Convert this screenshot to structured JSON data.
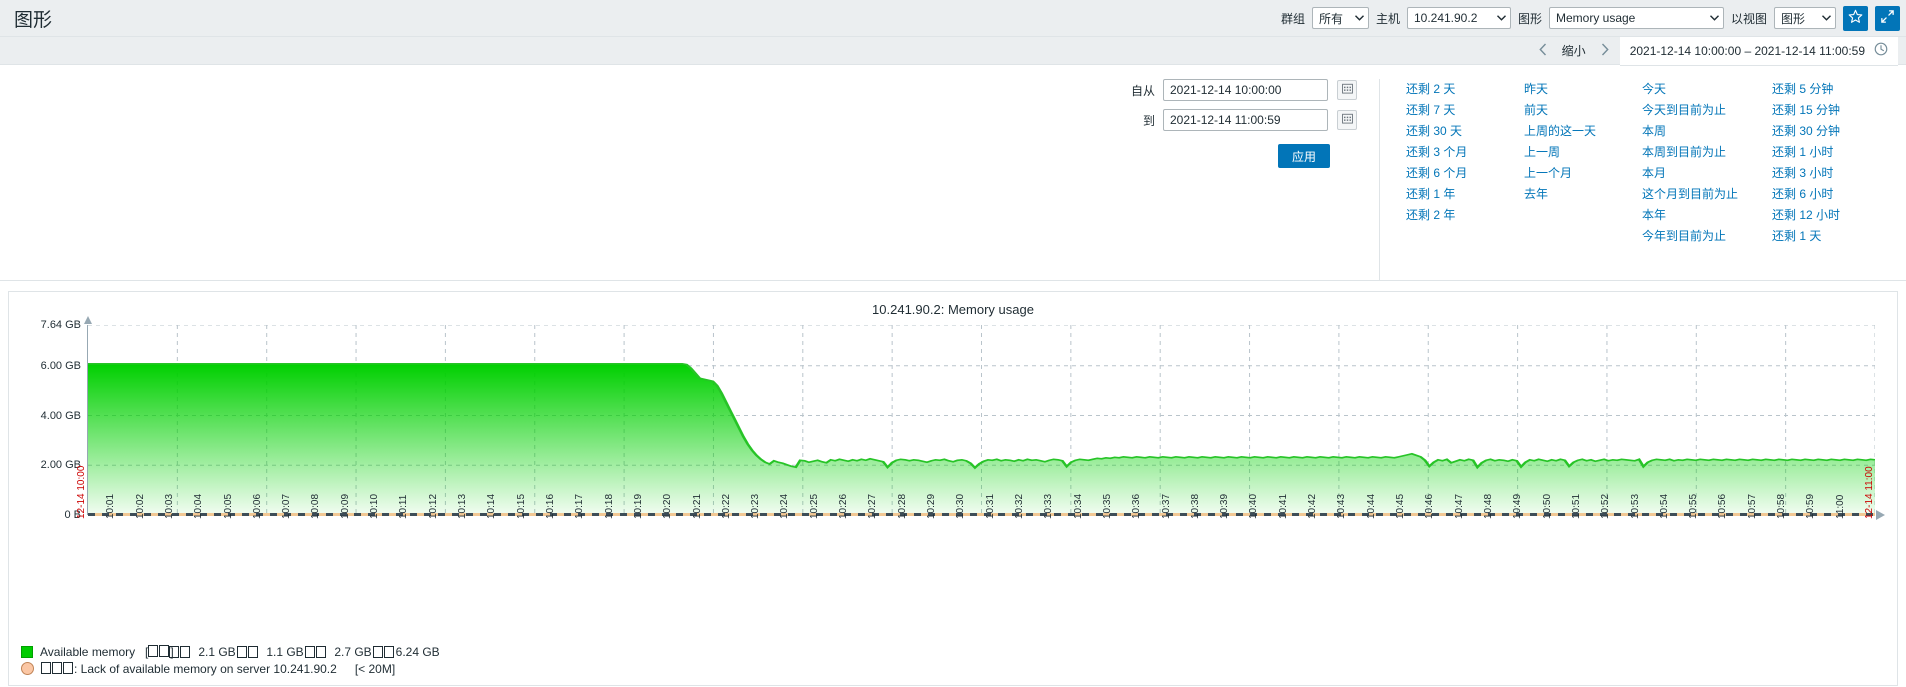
{
  "header": {
    "title": "图形",
    "group_label": "群组",
    "group_value": "所有",
    "host_label": "主机",
    "host_value": "10.241.90.2",
    "graph_label": "图形",
    "graph_value": "Memory usage",
    "view_label": "以视图",
    "view_value": "图形",
    "favorite_icon": "star-icon",
    "fullscreen_icon": "expand-icon"
  },
  "timebar": {
    "prev_icon": "chevron-left-icon",
    "zoom_out_label": "缩小",
    "next_icon": "chevron-right-icon",
    "range_text": "2021-12-14 10:00:00 – 2021-12-14 11:00:59",
    "clock_icon": "clock-icon"
  },
  "filter": {
    "from_label": "自从",
    "from_value": "2021-12-14 10:00:00",
    "to_label": "到",
    "to_value": "2021-12-14 11:00:59",
    "calendar_icon": "calendar-icon",
    "apply_label": "应用",
    "quick_columns": [
      [
        "还剩 2 天",
        "还剩 7 天",
        "还剩 30 天",
        "还剩 3 个月",
        "还剩 6 个月",
        "还剩 1 年",
        "还剩 2 年"
      ],
      [
        "昨天",
        "前天",
        "上周的这一天",
        "上一周",
        "上一个月",
        "去年"
      ],
      [
        "今天",
        "今天到目前为止",
        "本周",
        "本周到目前为止",
        "本月",
        "这个月到目前为止",
        "本年",
        "今年到目前为止"
      ],
      [
        "还剩 5 分钟",
        "还剩 15 分钟",
        "还剩 30 分钟",
        "还剩 1 小时",
        "还剩 3 小时",
        "还剩 6 小时",
        "还剩 12 小时",
        "还剩 1 天"
      ]
    ]
  },
  "chart_data": {
    "type": "area",
    "title": "10.241.90.2: Memory usage",
    "xlabel": "",
    "ylabel": "",
    "ylim": [
      0,
      7.64
    ],
    "yticks": [
      "0 B",
      "2.00 GB",
      "4.00 GB",
      "6.00 GB",
      "7.64 GB"
    ],
    "ytick_values": [
      0,
      2,
      4,
      6,
      7.64
    ],
    "grid": true,
    "legend_position": "bottom-left",
    "series": [
      {
        "name": "Available memory",
        "color": "#00cc00",
        "unit": "GB",
        "stats": {
          "min": "2.1 GB",
          "avg": "1.1 GB",
          "max": "2.7 GB",
          "last": "6.24 GB"
        },
        "values": [
          6.08,
          6.08,
          6.08,
          6.08,
          6.08,
          6.08,
          6.08,
          6.08,
          6.08,
          6.08,
          6.08,
          6.08,
          6.08,
          6.08,
          6.08,
          6.08,
          6.08,
          6.08,
          6.08,
          6.08,
          6.08,
          6.08,
          6.08,
          6.08,
          6.08,
          6.08,
          6.08,
          6.08,
          6.08,
          6.08,
          6.08,
          6.08,
          6.08,
          6.08,
          6.08,
          6.08,
          6.08,
          6.08,
          6.08,
          6.08,
          6.08,
          6.08,
          6.08,
          6.08,
          6.08,
          6.08,
          6.08,
          6.08,
          6.08,
          6.08,
          6.08,
          6.08,
          6.08,
          6.08,
          6.08,
          6.08,
          6.08,
          6.08,
          6.08,
          6.08,
          6.08,
          6.08,
          6.08,
          6.08,
          6.08,
          6.08,
          6.08,
          6.08,
          6.08,
          6.08,
          6.08,
          6.08,
          6.08,
          6.08,
          6.08,
          6.08,
          6.08,
          6.08,
          6.08,
          6.08,
          6.08,
          6.08,
          6.08,
          6.08,
          6.08,
          6.08,
          6.08,
          6.08,
          6.08,
          6.08,
          6.08,
          6.08,
          6.08,
          6.08,
          6.08,
          6.08,
          6.08,
          6.08,
          6.08,
          6.08,
          6.08,
          6.08,
          6.08,
          6.08,
          6.08,
          6.08,
          6.08,
          6.08,
          6.08,
          6.08,
          6.08,
          6.08,
          6.08,
          6.08,
          6.08,
          6.08,
          6.08,
          6.08,
          6.08,
          6.08,
          6.08,
          6.08,
          6.08,
          6.08,
          6.08,
          6.08,
          6.08,
          6.08,
          6.08,
          6.08,
          6.08,
          6.08,
          6.08,
          6.08,
          6.08,
          6.08,
          6.08,
          6.05,
          5.9,
          5.7,
          5.5,
          5.46,
          5.42,
          5.38,
          5.2,
          4.9,
          4.55,
          4.2,
          3.85,
          3.5,
          3.15,
          2.85,
          2.6,
          2.4,
          2.24,
          2.12,
          2.05,
          2.18,
          2.12,
          2.08,
          2.02,
          1.96,
          1.92,
          2.2,
          2.18,
          2.12,
          2.16,
          2.2,
          2.14,
          2.1,
          2.22,
          2.18,
          2.24,
          2.2,
          2.16,
          2.22,
          2.18,
          2.24,
          2.2,
          2.26,
          2.22,
          2.18,
          2.14,
          1.92,
          2.1,
          2.2,
          2.24,
          2.22,
          2.18,
          2.22,
          2.2,
          2.16,
          2.12,
          2.18,
          2.22,
          2.2,
          2.24,
          2.18,
          2.14,
          2.2,
          2.22,
          2.18,
          2.08,
          1.9,
          2.06,
          2.16,
          2.22,
          2.2,
          2.24,
          2.18,
          2.22,
          2.2,
          2.16,
          2.22,
          2.18,
          2.24,
          2.2,
          2.22,
          2.18,
          2.14,
          2.2,
          2.24,
          2.22,
          2.18,
          1.95,
          2.12,
          2.2,
          2.24,
          2.22,
          2.2,
          2.24,
          2.28,
          2.26,
          2.3,
          2.28,
          2.32,
          2.3,
          2.34,
          2.32,
          2.3,
          2.34,
          2.32,
          2.3,
          2.34,
          2.32,
          2.3,
          2.34,
          2.32,
          2.3,
          2.34,
          2.32,
          2.3,
          2.34,
          2.32,
          2.3,
          2.34,
          2.32,
          2.3,
          2.34,
          2.32,
          2.3,
          2.34,
          2.32,
          2.3,
          2.34,
          2.32,
          2.3,
          2.34,
          2.32,
          2.3,
          2.34,
          2.32,
          2.3,
          2.34,
          2.32,
          2.3,
          2.34,
          2.32,
          2.3,
          2.34,
          2.32,
          2.3,
          2.34,
          2.32,
          2.3,
          2.34,
          2.32,
          2.3,
          2.34,
          2.32,
          2.3,
          2.34,
          2.32,
          2.3,
          2.34,
          2.32,
          2.3,
          2.34,
          2.32,
          2.3,
          2.34,
          2.38,
          2.42,
          2.46,
          2.4,
          2.34,
          2.2,
          1.96,
          2.12,
          2.22,
          2.18,
          2.24,
          2.1,
          2.16,
          2.22,
          2.18,
          2.24,
          2.2,
          1.92,
          2.1,
          2.2,
          2.24,
          2.18,
          2.22,
          2.2,
          2.16,
          2.22,
          2.18,
          1.94,
          2.12,
          2.22,
          2.18,
          2.24,
          2.2,
          2.16,
          2.22,
          2.18,
          2.24,
          2.2,
          1.96,
          2.12,
          2.2,
          2.24,
          2.18,
          2.22,
          2.16,
          2.2,
          2.24,
          2.18,
          2.22,
          2.2,
          2.24,
          2.22,
          2.2,
          2.18,
          2.24,
          1.95,
          2.12,
          2.2,
          2.24,
          2.22,
          2.2,
          2.24,
          2.18,
          2.22,
          2.2,
          2.24,
          2.22,
          2.2,
          2.24,
          2.22,
          2.2,
          2.24,
          2.22,
          2.2,
          2.24,
          2.22,
          2.2,
          2.24,
          2.22,
          2.2,
          2.24,
          2.22,
          2.2,
          2.24,
          2.22,
          2.2,
          2.24,
          2.22,
          2.2,
          2.24,
          2.22,
          2.2,
          2.24,
          2.22,
          2.2,
          2.24,
          2.22,
          2.2,
          2.24,
          2.22,
          2.2,
          2.24,
          2.22,
          2.2,
          2.24,
          2.22,
          2.2,
          2.24,
          2.22
        ]
      }
    ],
    "legend": {
      "series_name": "Available memory",
      "bracket_tofu": "[□□]",
      "stat_headers": [
        "□□",
        "□□",
        "□□",
        "□□"
      ],
      "stat_values": [
        "2.1 GB",
        "1.1 GB",
        "2.7 GB",
        "6.24 GB"
      ],
      "trigger_label": "□□□: Lack of available memory on server 10.241.90.2",
      "trigger_threshold": "[< 20M]"
    },
    "xticks": [
      "12-14 10:00",
      "10:01",
      "10:02",
      "10:03",
      "10:04",
      "10:05",
      "10:06",
      "10:07",
      "10:08",
      "10:09",
      "10:10",
      "10:11",
      "10:12",
      "10:13",
      "10:14",
      "10:15",
      "10:16",
      "10:17",
      "10:18",
      "10:19",
      "10:20",
      "10:21",
      "10:22",
      "10:23",
      "10:24",
      "10:25",
      "10:26",
      "10:27",
      "10:28",
      "10:29",
      "10:30",
      "10:31",
      "10:32",
      "10:33",
      "10:34",
      "10:35",
      "10:36",
      "10:37",
      "10:38",
      "10:39",
      "10:40",
      "10:41",
      "10:42",
      "10:43",
      "10:44",
      "10:45",
      "10:46",
      "10:47",
      "10:48",
      "10:49",
      "10:50",
      "10:51",
      "10:52",
      "10:53",
      "10:54",
      "10:55",
      "10:56",
      "10:57",
      "10:58",
      "10:59",
      "11:00",
      "12-14 11:00"
    ],
    "xtick_edges": [
      0,
      61,
      62
    ]
  }
}
